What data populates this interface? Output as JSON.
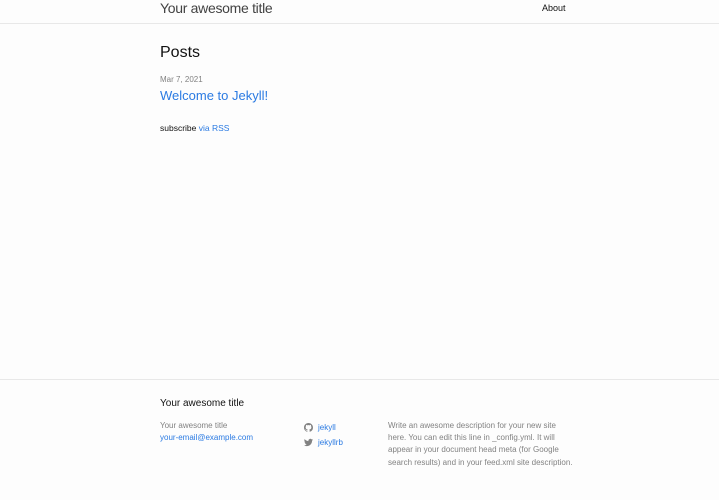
{
  "header": {
    "site_title": "Your awesome title",
    "nav": {
      "about": "About"
    }
  },
  "main": {
    "heading": "Posts",
    "posts": [
      {
        "date": "Mar 7, 2021",
        "title": "Welcome to Jekyll!"
      }
    ],
    "rss": {
      "prefix": "subscribe",
      "link_text": "via RSS"
    }
  },
  "footer": {
    "heading": "Your awesome title",
    "name": "Your awesome title",
    "email": "your-email@example.com",
    "social": [
      {
        "icon": "github-icon",
        "label": "jekyll"
      },
      {
        "icon": "twitter-icon",
        "label": "jekyllrb"
      }
    ],
    "description": "Write an awesome description for your new site here. You can edit this line in _config.yml. It will appear in your document head meta (for Google search results) and in your feed.xml site description."
  },
  "colors": {
    "link": "#2a7ae2",
    "muted": "#828282",
    "border": "#e8e8e8",
    "background": "#fdfdfd"
  }
}
